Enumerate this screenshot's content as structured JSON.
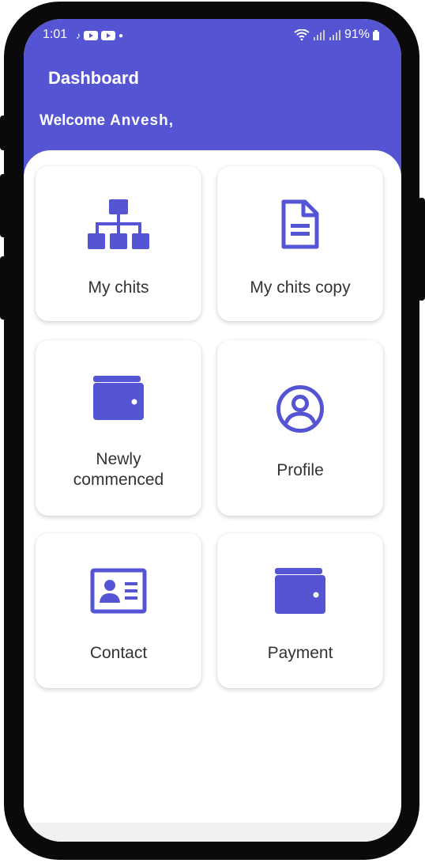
{
  "status": {
    "time": "1:01",
    "battery": "91%"
  },
  "header": {
    "title": "Dashboard",
    "welcome": "Welcome",
    "user_name": "Anvesh,"
  },
  "cards": [
    {
      "label": "My chits",
      "icon": "org-chart-icon"
    },
    {
      "label": "My chits copy",
      "icon": "document-icon"
    },
    {
      "label": "Newly commenced",
      "icon": "wallet-icon"
    },
    {
      "label": "Profile",
      "icon": "user-circle-icon"
    },
    {
      "label": "Contact",
      "icon": "contact-card-icon"
    },
    {
      "label": "Payment",
      "icon": "wallet-icon"
    }
  ],
  "colors": {
    "accent": "#5555d4",
    "card_text": "#333333"
  }
}
